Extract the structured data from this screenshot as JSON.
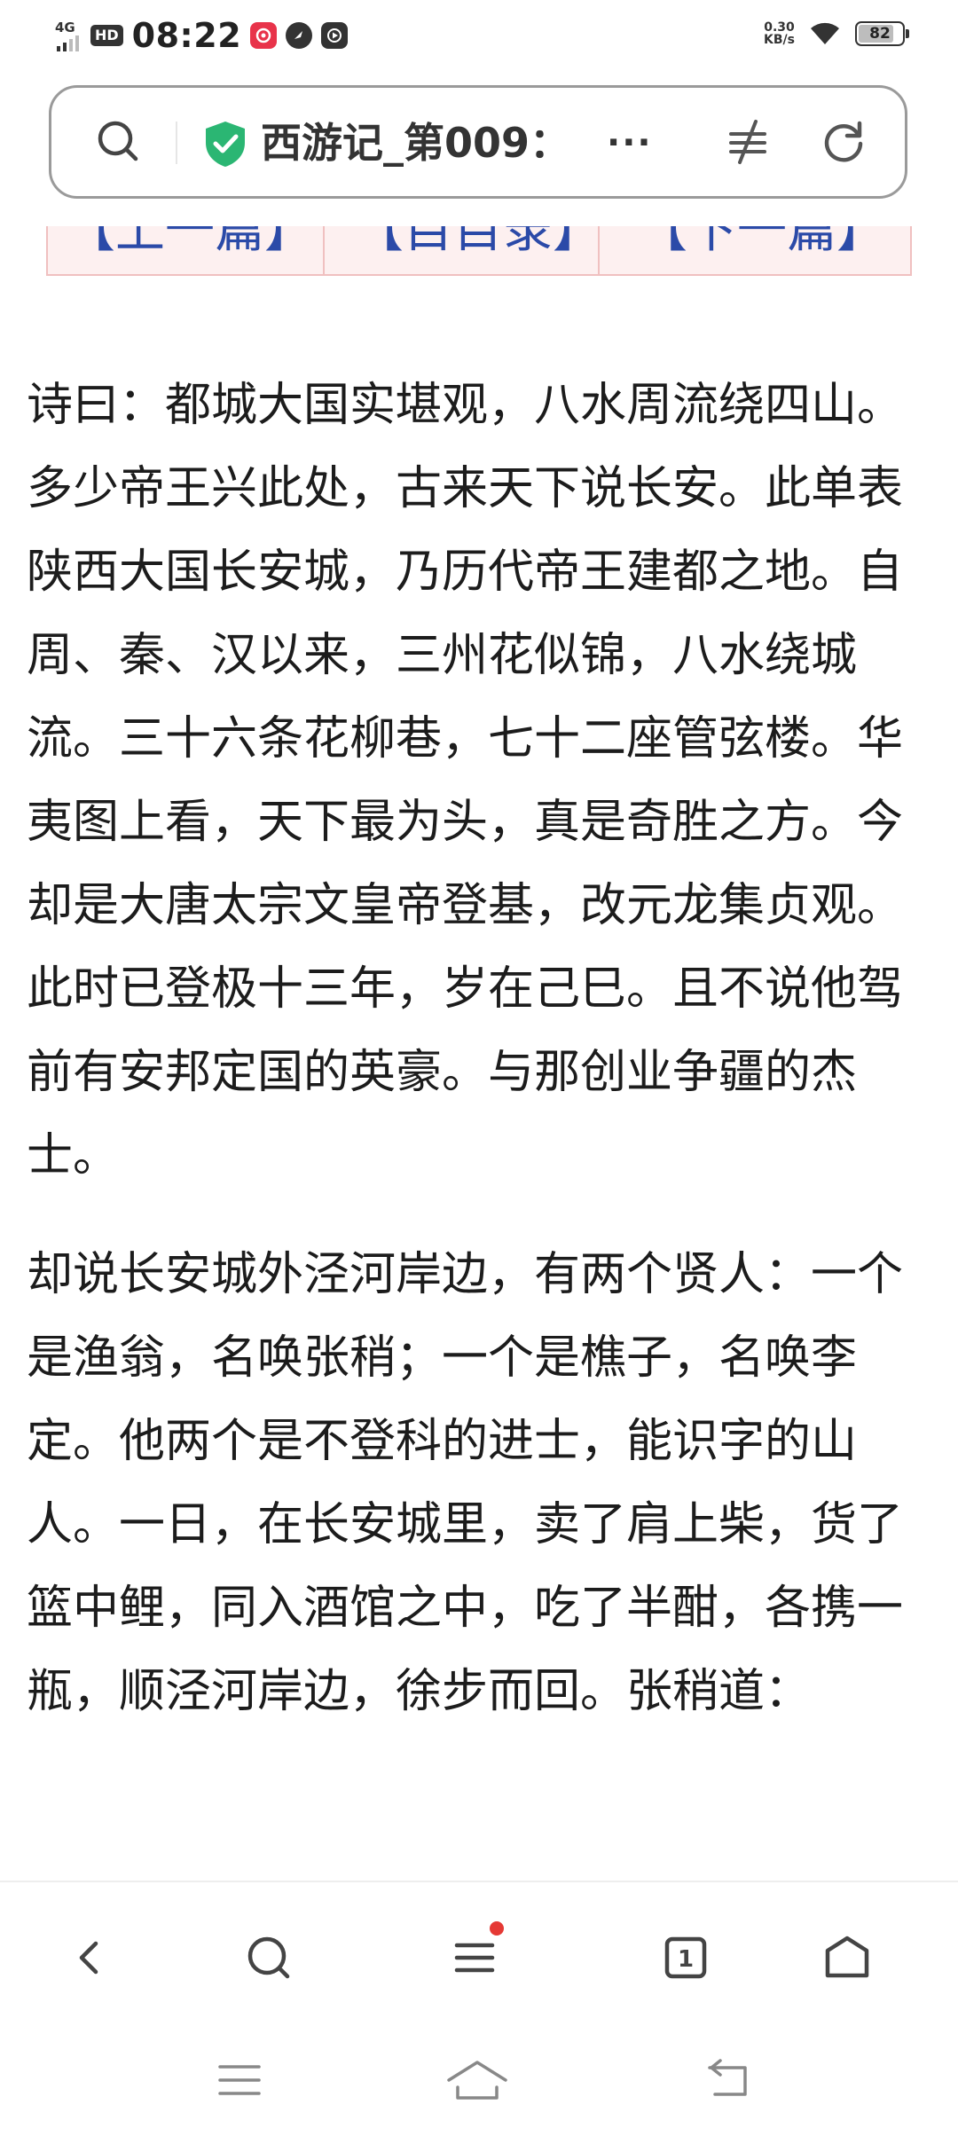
{
  "status_bar": {
    "network": "4G",
    "hd": "HD",
    "time": "08:22",
    "speed_value": "0.30",
    "speed_unit": "KB/s",
    "battery_level": "82",
    "battery_fraction": 0.82,
    "app_icons": [
      "app-notification-icon",
      "app-circle-icon",
      "app-play-icon"
    ]
  },
  "address_bar": {
    "title": "西游记_第009：",
    "more": "···",
    "icons": [
      "search-icon",
      "shield-check-icon",
      "filter-icon",
      "refresh-icon"
    ],
    "shield_color": "#2bb673"
  },
  "top_nav": {
    "prev": "【上一篇】",
    "toc": "【目目录】",
    "next": "【下一篇】",
    "link_color": "#2b4aa8"
  },
  "article": {
    "paragraphs": [
      "诗曰：都城大国实堪观，八水周流绕四山。多少帝王兴此处，古来天下说长安。此单表陕西大国长安城，乃历代帝王建都之地。自周、秦、汉以来，三州花似锦，八水绕城流。三十六条花柳巷，七十二座管弦楼。华夷图上看，天下最为头，真是奇胜之方。今却是大唐太宗文皇帝登基，改元龙集贞观。此时已登极十三年，岁在己巳。且不说他驾前有安邦定国的英豪。与那创业争疆的杰士。",
      "却说长安城外泾河岸边，有两个贤人：一个是渔翁，名唤张稍；一个是樵子，名唤李定。他两个是不登科的进士，能识字的山人。一日，在长安城里，卖了肩上柴，货了篮中鲤，同入酒馆之中，吃了半酣，各携一瓶，顺泾河岸边，徐步而回。张稍道："
    ]
  },
  "bottom_toolbar": {
    "tabs_count": "1",
    "icons": [
      "back-icon",
      "search-icon",
      "menu-icon",
      "tabs-icon",
      "home-icon"
    ],
    "badge_color": "#e53935"
  },
  "system_nav": {
    "icons": [
      "recents-icon",
      "home-icon",
      "back-icon"
    ]
  }
}
